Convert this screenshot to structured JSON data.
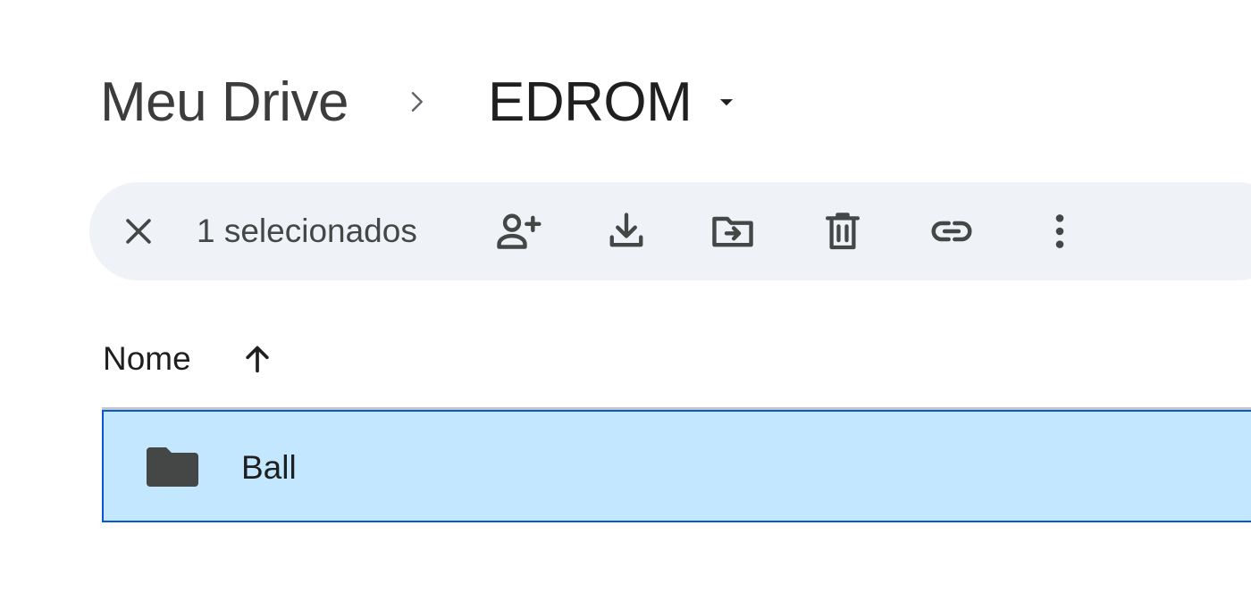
{
  "breadcrumb": {
    "root_label": "Meu Drive",
    "separator_icon": "chevron-right-icon",
    "current_label": "EDROM",
    "current_dropdown_icon": "caret-down-icon"
  },
  "selection_bar": {
    "count_label": "1 selecionados",
    "actions": [
      {
        "name": "clear-selection",
        "icon": "close-icon"
      },
      {
        "name": "share",
        "icon": "person-add-icon"
      },
      {
        "name": "download",
        "icon": "download-icon"
      },
      {
        "name": "move",
        "icon": "move-to-folder-icon"
      },
      {
        "name": "delete",
        "icon": "trash-icon"
      },
      {
        "name": "copy-link",
        "icon": "link-icon"
      },
      {
        "name": "more-actions",
        "icon": "more-vert-icon"
      }
    ],
    "background_color": "#eff2f7"
  },
  "list": {
    "header": {
      "name_label": "Nome",
      "sort_icon": "arrow-up-icon"
    },
    "rows": [
      {
        "icon": "folder-icon",
        "name": "Ball",
        "selected": true
      }
    ]
  },
  "colors": {
    "selected_row_bg": "#c2e7ff",
    "selected_row_border": "#0b57d0",
    "icon_color": "#444746"
  }
}
